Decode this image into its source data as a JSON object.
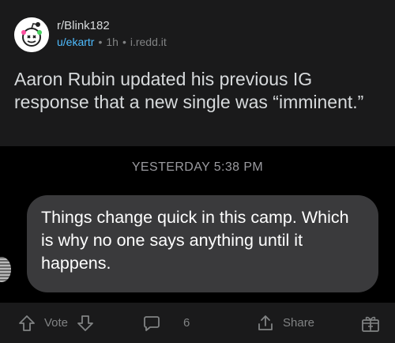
{
  "post": {
    "subreddit": "r/Blink182",
    "author": "u/ekartr",
    "age": "1h",
    "domain": "i.redd.it",
    "title": "Aaron Rubin updated his previous IG response that a new single was “imminent.”"
  },
  "image": {
    "timestamp": "YESTERDAY 5:38 PM",
    "message": "Things change quick in this camp. Which is why no one says anything until it happens."
  },
  "actions": {
    "vote_label": "Vote",
    "comment_count": "6",
    "share_label": "Share"
  },
  "icons": {
    "upvote": "upvote-arrow-icon",
    "downvote": "downvote-arrow-icon",
    "comment": "comment-bubble-icon",
    "share": "share-upload-icon",
    "award": "award-gift-icon"
  },
  "colors": {
    "background": "#1a1a1b",
    "username": "#4fbcff",
    "bubble": "#3a3a3c"
  }
}
